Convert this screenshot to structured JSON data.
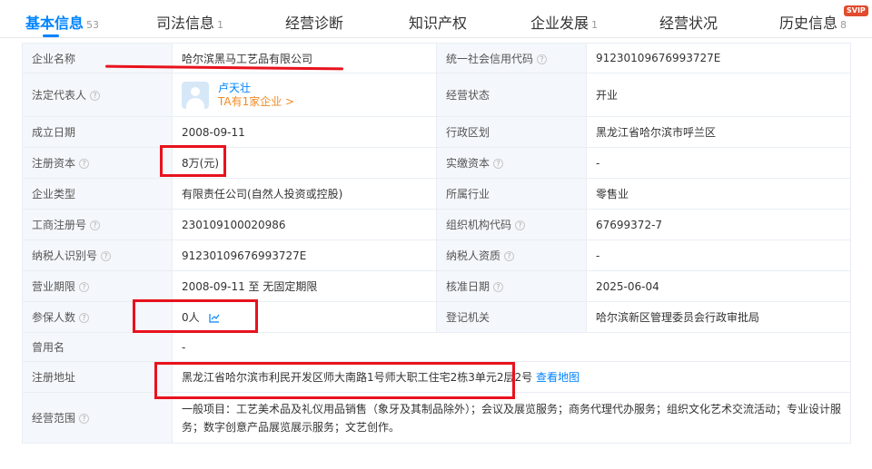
{
  "tabs": [
    {
      "label": "基本信息",
      "count": "53"
    },
    {
      "label": "司法信息",
      "count": "1"
    },
    {
      "label": "经营诊断",
      "count": ""
    },
    {
      "label": "知识产权",
      "count": ""
    },
    {
      "label": "企业发展",
      "count": "1"
    },
    {
      "label": "经营状况",
      "count": ""
    },
    {
      "label": "历史信息",
      "count": "8"
    }
  ],
  "svip_badge": "SVIP",
  "rows": {
    "company_name": {
      "label": "企业名称",
      "value": "哈尔滨黑马工艺品有限公司"
    },
    "credit_code": {
      "label": "统一社会信用代码",
      "value": "91230109676993727E"
    },
    "legal_rep": {
      "label": "法定代表人",
      "name": "卢天壮",
      "link": "TA有1家企业 >"
    },
    "status": {
      "label": "经营状态",
      "value": "开业"
    },
    "found_date": {
      "label": "成立日期",
      "value": "2008-09-11"
    },
    "region": {
      "label": "行政区划",
      "value": "黑龙江省哈尔滨市呼兰区"
    },
    "reg_capital": {
      "label": "注册资本",
      "value": "8万(元)"
    },
    "paid_capital": {
      "label": "实缴资本",
      "value": "-"
    },
    "company_type": {
      "label": "企业类型",
      "value": "有限责任公司(自然人投资或控股)"
    },
    "industry": {
      "label": "所属行业",
      "value": "零售业"
    },
    "reg_no": {
      "label": "工商注册号",
      "value": "230109100020986"
    },
    "org_code": {
      "label": "组织机构代码",
      "value": "67699372-7"
    },
    "tax_id": {
      "label": "纳税人识别号",
      "value": "91230109676993727E"
    },
    "tax_qual": {
      "label": "纳税人资质",
      "value": "-"
    },
    "term": {
      "label": "营业期限",
      "value": "2008-09-11 至 无固定期限"
    },
    "approve_date": {
      "label": "核准日期",
      "value": "2025-06-04"
    },
    "insured": {
      "label": "参保人数",
      "value": "0人"
    },
    "authority": {
      "label": "登记机关",
      "value": "哈尔滨新区管理委员会行政审批局"
    },
    "former_name": {
      "label": "曾用名",
      "value": "-"
    },
    "address": {
      "label": "注册地址",
      "value": "黑龙江省哈尔滨市利民开发区师大南路1号师大职工住宅2栋3单元2层2号",
      "map_link": "查看地图"
    },
    "scope": {
      "label": "经营范围",
      "value": "一般项目：工艺美术品及礼仪用品销售（象牙及其制品除外）；会议及展览服务；商务代理代办服务；组织文化艺术交流活动；专业设计服务；数字创意产品展览展示服务；文艺创作。"
    }
  },
  "colors": {
    "accent": "#0084ff",
    "annotation": "#e8121d",
    "link_orange": "#f08a24"
  },
  "icons": [
    "help-icon",
    "avatar-icon",
    "trend-chart-icon"
  ]
}
